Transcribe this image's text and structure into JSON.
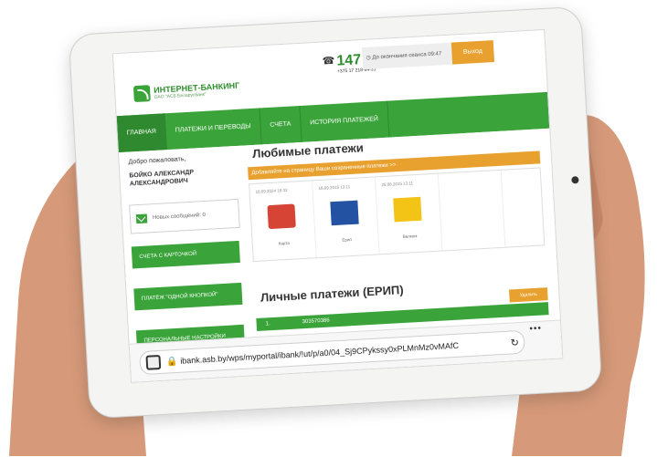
{
  "header": {
    "brand_title": "ИНТЕРНЕТ-БАНКИНГ",
    "brand_sub": "ОАО \"АСБ Беларусбанк\"",
    "phone": "147",
    "phone_sub": "+375 17 218-84-31",
    "session": "До окончания сеанса 09:47",
    "exit_label": "Выход"
  },
  "nav": {
    "items": [
      {
        "label": "ГЛАВНАЯ"
      },
      {
        "label": "ПЛАТЕЖИ И ПЕРЕВОДЫ"
      },
      {
        "label": "СЧЕТА"
      },
      {
        "label": "ИСТОРИЯ ПЛАТЕЖЕЙ"
      }
    ]
  },
  "sidebar": {
    "welcome": "Добро пожаловать,",
    "name": "БОЙКО АЛЕКСАНДР АЛЕКСАНДРОВИЧ",
    "messages": "Новых сообщений: 0",
    "buttons": [
      {
        "label": "СЧЕТА С КАРТОЧКОЙ"
      },
      {
        "label": "ПЛАТЁЖ \"ОДНОЙ КНОПКОЙ\""
      },
      {
        "label": "ПЕРСОНАЛЬНЫЕ НАСТРОЙКИ"
      }
    ]
  },
  "main": {
    "fav_title": "Любимые платежи",
    "fav_banner": "Добавляйте на страницу Ваши сохраненные платежи >>",
    "cards": [
      {
        "date": "16.09.2024 16:32",
        "label": "Карта",
        "icon": "perevody-logo"
      },
      {
        "date": "16.09.2015 13:11",
        "label": "Ерип",
        "icon": "cosmos-logo"
      },
      {
        "date": "25.08.2015 13:11",
        "label": "Велком",
        "icon": "velcom-logo"
      }
    ],
    "erip_title": "Личные платежи (ЕРИП)",
    "delete_label": "Удалить",
    "erip_rows": [
      {
        "index": "1.",
        "number": "303570386"
      }
    ]
  },
  "browser": {
    "url": "ibank.asb.by/wps/myportal/ibank/!ut/p/a0/04_Sj9CPykssy0xPLMnMz0vMAfC"
  },
  "colors": {
    "primary_green": "#3aa43a",
    "accent_orange": "#e8a12f"
  }
}
